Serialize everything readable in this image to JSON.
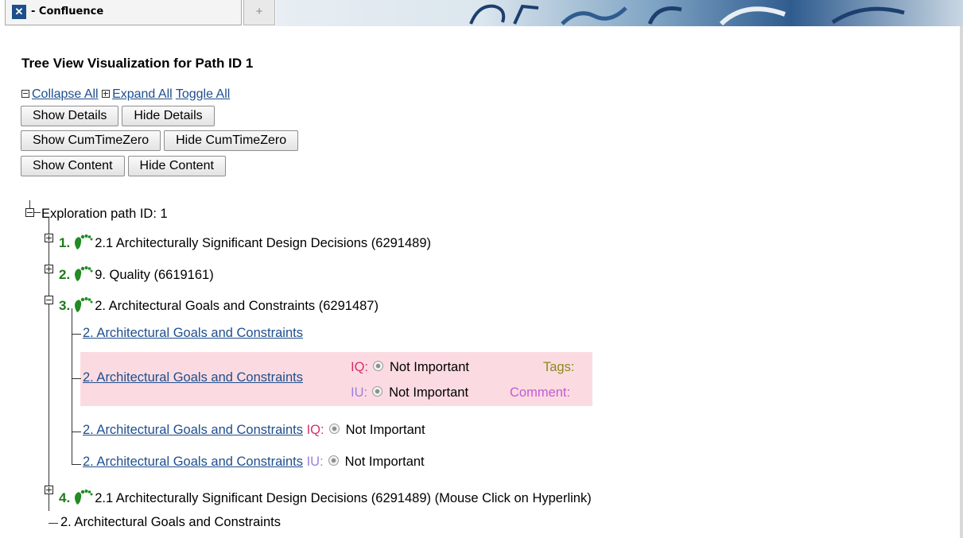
{
  "tab": {
    "icon": "confluence-x-icon",
    "title": "- Confluence",
    "new_tab_symbol": "+"
  },
  "page": {
    "title": "Tree View Visualization for Path ID 1"
  },
  "toggles": {
    "collapse": "Collapse All",
    "expand": "Expand All",
    "toggle": "Toggle All"
  },
  "buttons": {
    "show_details": "Show Details",
    "hide_details": "Hide Details",
    "show_cum": "Show CumTimeZero",
    "hide_cum": "Hide CumTimeZero",
    "show_content": "Show Content",
    "hide_content": "Hide Content"
  },
  "tree": {
    "root": "Exploration path ID: 1",
    "nodes": [
      {
        "num": "1.",
        "label": "2.1 Architecturally Significant Design Decisions (6291489)",
        "state": "collapsed"
      },
      {
        "num": "2.",
        "label": "9. Quality (6619161)",
        "state": "collapsed"
      },
      {
        "num": "3.",
        "label": "2. Architectural Goals and Constraints (6291487)",
        "state": "expanded"
      },
      {
        "num": "4.",
        "label": "2.1 Architecturally Significant Design Decisions (6291489) (Mouse Click on Hyperlink)",
        "state": "collapsed"
      }
    ],
    "children": {
      "link1": "2. Architectural Goals and Constraints",
      "detail_link": "2. Architectural Goals and Constraints",
      "iq_label": "IQ:",
      "iu_label": "IU:",
      "iq_value": "Not Important",
      "iu_value": "Not Important",
      "tags_label": "Tags:",
      "comment_label": "Comment:",
      "link3": "2. Architectural Goals and Constraints",
      "link3_iq": "IQ:",
      "link3_value": "Not Important",
      "link4": "2. Architectural Goals and Constraints",
      "link4_iu": "IU:",
      "link4_value": "Not Important"
    },
    "last_leaf": "2. Architectural Goals and Constraints"
  },
  "colors": {
    "link": "#1f4e8c",
    "node_number": "#1d7a1d",
    "iq": "#d6306c",
    "iu": "#9a7fe0",
    "detail_bg": "#fbdbe1"
  }
}
